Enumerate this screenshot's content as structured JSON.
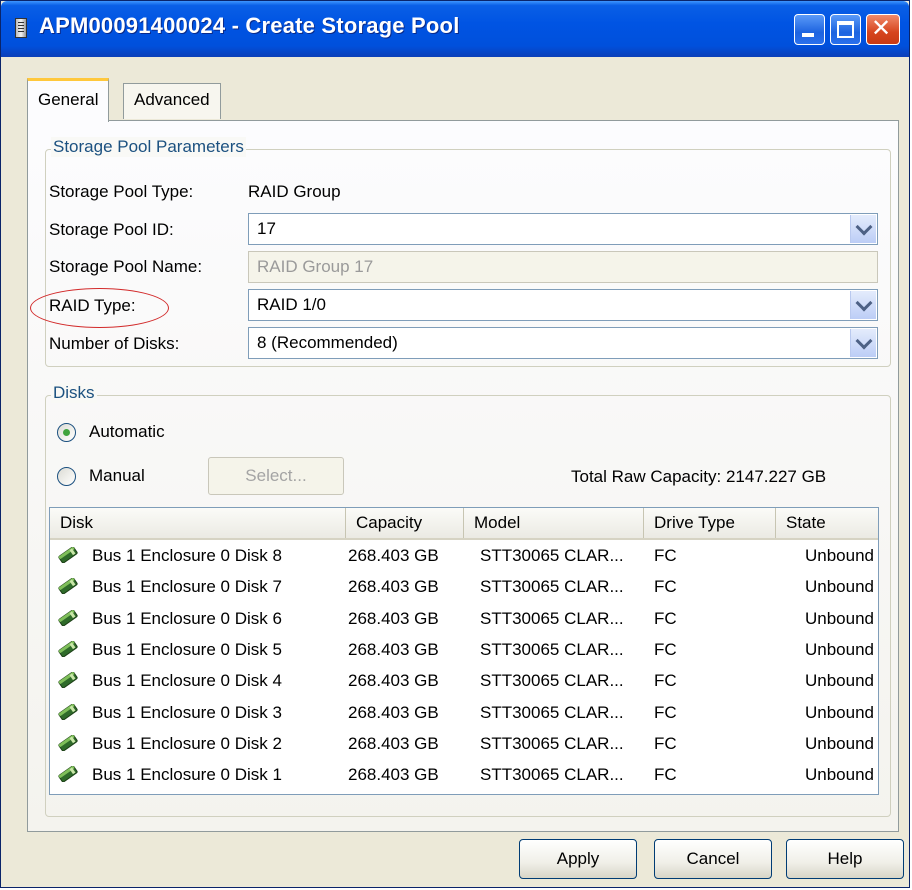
{
  "window": {
    "title": "APM00091400024 - Create Storage Pool"
  },
  "tabs": [
    {
      "label": "General",
      "active": true
    },
    {
      "label": "Advanced",
      "active": false
    }
  ],
  "params": {
    "group_title": "Storage Pool Parameters",
    "pool_type_label": "Storage Pool Type:",
    "pool_type_value": "RAID Group",
    "pool_id_label": "Storage Pool ID:",
    "pool_id_value": "17",
    "pool_name_label": "Storage Pool Name:",
    "pool_name_value": "RAID Group 17",
    "raid_type_label": "RAID Type:",
    "raid_type_value": "RAID 1/0",
    "num_disks_label": "Number of Disks:",
    "num_disks_value": "8 (Recommended)"
  },
  "disks": {
    "group_title": "Disks",
    "automatic_label": "Automatic",
    "manual_label": "Manual",
    "selected_mode": "Automatic",
    "select_button": "Select...",
    "total_capacity": "Total Raw Capacity: 2147.227 GB",
    "columns": [
      "Disk",
      "Capacity",
      "Model",
      "Drive Type",
      "State"
    ],
    "rows": [
      {
        "disk": "Bus 1 Enclosure 0 Disk 8",
        "capacity": "268.403 GB",
        "model": "STT30065 CLAR...",
        "drive_type": "FC",
        "state": "Unbound"
      },
      {
        "disk": "Bus 1 Enclosure 0 Disk 7",
        "capacity": "268.403 GB",
        "model": "STT30065 CLAR...",
        "drive_type": "FC",
        "state": "Unbound"
      },
      {
        "disk": "Bus 1 Enclosure 0 Disk 6",
        "capacity": "268.403 GB",
        "model": "STT30065 CLAR...",
        "drive_type": "FC",
        "state": "Unbound"
      },
      {
        "disk": "Bus 1 Enclosure 0 Disk 5",
        "capacity": "268.403 GB",
        "model": "STT30065 CLAR...",
        "drive_type": "FC",
        "state": "Unbound"
      },
      {
        "disk": "Bus 1 Enclosure 0 Disk 4",
        "capacity": "268.403 GB",
        "model": "STT30065 CLAR...",
        "drive_type": "FC",
        "state": "Unbound"
      },
      {
        "disk": "Bus 1 Enclosure 0 Disk 3",
        "capacity": "268.403 GB",
        "model": "STT30065 CLAR...",
        "drive_type": "FC",
        "state": "Unbound"
      },
      {
        "disk": "Bus 1 Enclosure 0 Disk 2",
        "capacity": "268.403 GB",
        "model": "STT30065 CLAR...",
        "drive_type": "FC",
        "state": "Unbound"
      },
      {
        "disk": "Bus 1 Enclosure 0 Disk 1",
        "capacity": "268.403 GB",
        "model": "STT30065 CLAR...",
        "drive_type": "FC",
        "state": "Unbound"
      }
    ]
  },
  "buttons": {
    "apply": "Apply",
    "cancel": "Cancel",
    "help": "Help"
  },
  "icons": {
    "app": "storage-icon",
    "disk": "disk-drive-icon",
    "dropdown": "chevron-down-icon"
  },
  "colors": {
    "titlebar": "#0054e3",
    "group_title": "#1c5180",
    "highlight_ellipse": "#d22a2a",
    "tab_accent": "#ffc83c"
  }
}
